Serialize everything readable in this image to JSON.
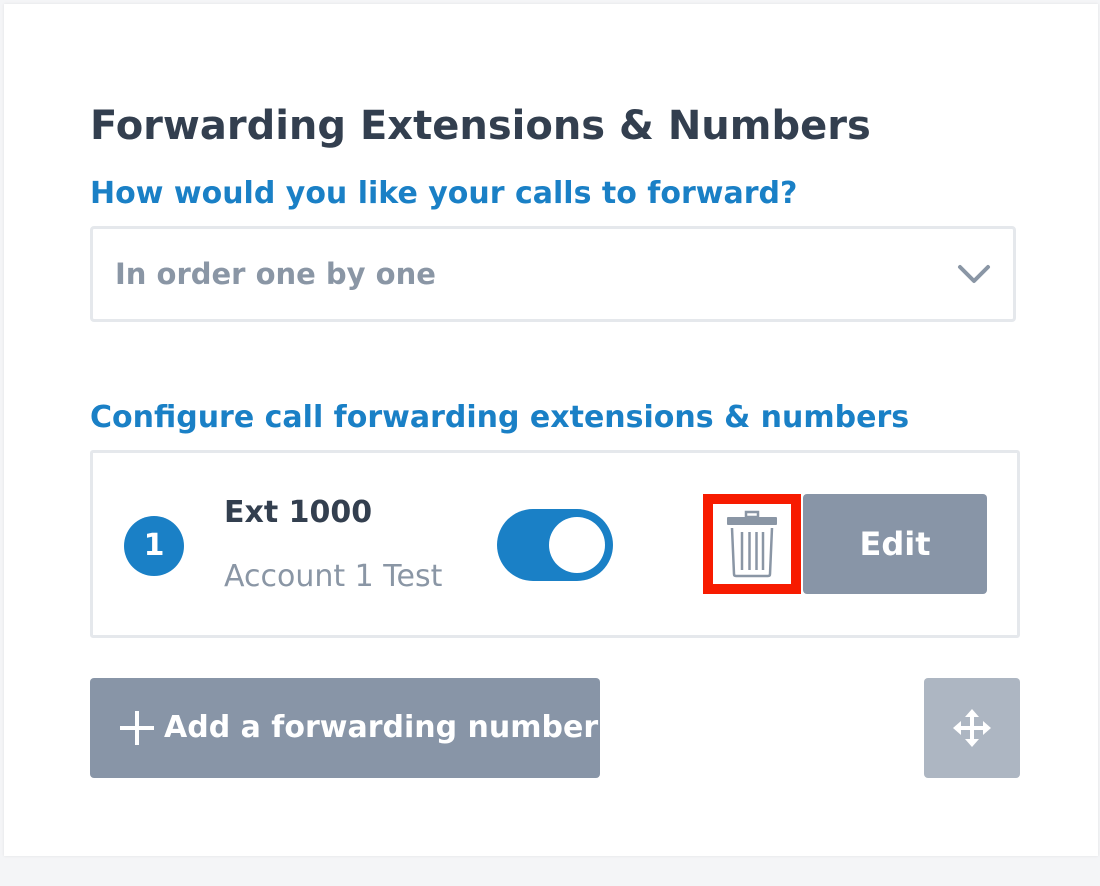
{
  "title": "Forwarding Extensions & Numbers",
  "forward_mode": {
    "label": "How would you like your calls to forward?",
    "selected": "In order one by one",
    "icon": "chevron-down-icon"
  },
  "forwarding_list": {
    "label": "Configure call forwarding extensions & numbers",
    "items": [
      {
        "order": "1",
        "name": "Ext 1000",
        "account": "Account 1 Test",
        "enabled": true,
        "delete_icon": "trash-icon",
        "edit_label": "Edit"
      }
    ]
  },
  "actions": {
    "add_label": "Add a forwarding number",
    "add_icon": "plus-icon",
    "reorder_icon": "move-icon"
  },
  "colors": {
    "accent": "#1a80c6",
    "title_text": "#333f4f",
    "muted_text": "#8a96a5",
    "button_gray": "#8895a7",
    "button_light": "#adb6c2",
    "highlight": "#f71b00"
  }
}
